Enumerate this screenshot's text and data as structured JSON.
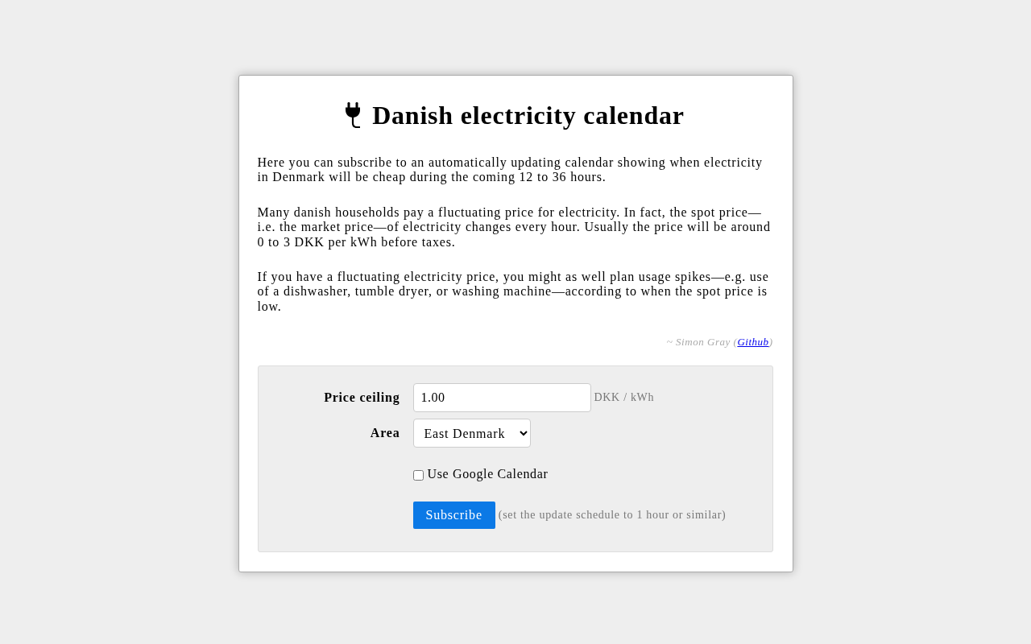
{
  "title": {
    "text": "Danish electricity calendar"
  },
  "paragraphs": [
    "Here you can subscribe to an automatically updating calendar showing when electricity in Denmark will be cheap during the coming 12 to 36 hours.",
    "Many danish households pay a fluctuating price for electricity. In fact, the spot price—i.e. the market price—of electricity changes every hour. Usually the price will be around 0 to 3 DKK per kWh before taxes.",
    "If you have a fluctuating electricity price, you might as well plan usage spikes—e.g. use of a dishwasher, tumble dryer, or washing machine—according to when the spot price is low."
  ],
  "credit": {
    "text_before": "~ Simon Gray (",
    "link": "Github",
    "text_after": ")"
  },
  "form": {
    "fields": [
      {
        "kind": "text",
        "label": "Price ceiling",
        "value": "1.00",
        "unit": "DKK / kWh"
      },
      {
        "kind": "select",
        "label": "Area",
        "value": "East Denmark"
      }
    ],
    "checkbox": {
      "label": "Use Google Calendar",
      "checked": false
    },
    "submit": {
      "label": "Subscribe",
      "note": "(set the update schedule to 1 hour or similar)"
    }
  }
}
